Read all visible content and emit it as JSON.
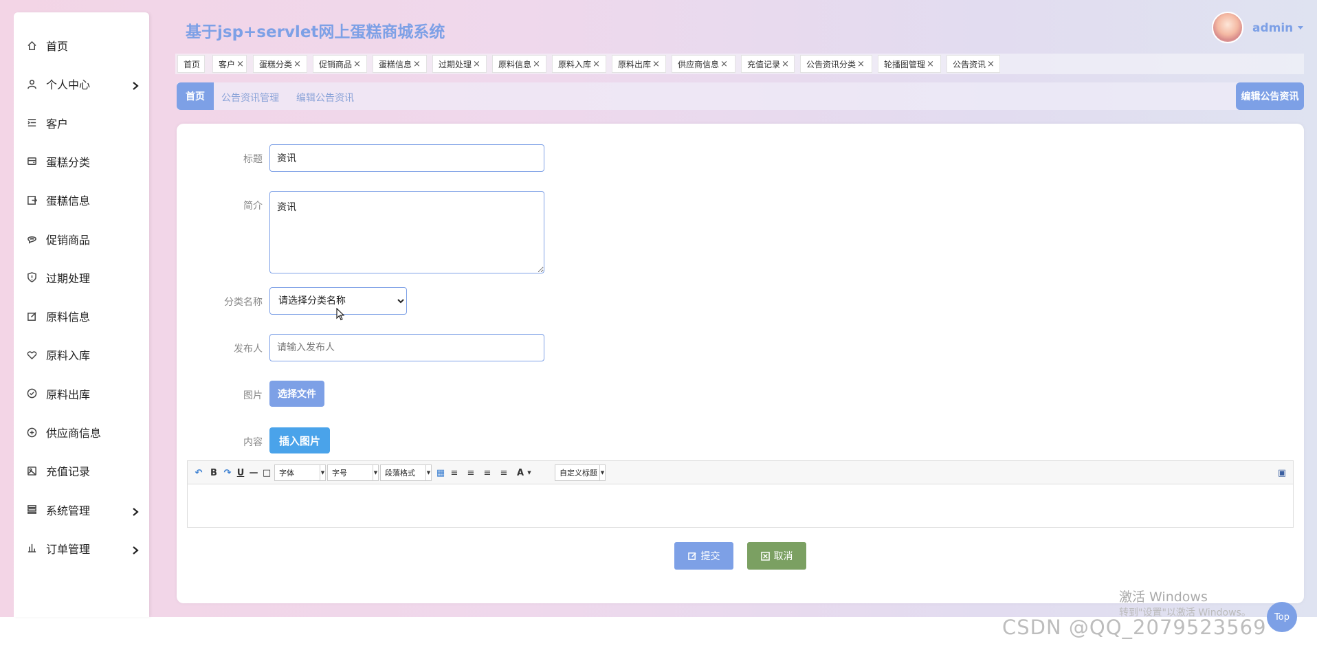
{
  "header": {
    "title": "基于jsp+servlet网上蛋糕商城系统",
    "username": "admin"
  },
  "sidebar": {
    "items": [
      {
        "label": "首页",
        "icon": "home-icon",
        "has_children": false
      },
      {
        "label": "个人中心",
        "icon": "user-icon",
        "has_children": true
      },
      {
        "label": "客户",
        "icon": "list-indent-icon",
        "has_children": false
      },
      {
        "label": "蛋糕分类",
        "icon": "wallet-icon",
        "has_children": false
      },
      {
        "label": "蛋糕信息",
        "icon": "exit-box-icon",
        "has_children": false
      },
      {
        "label": "促销商品",
        "icon": "chat-bubble-icon",
        "has_children": false
      },
      {
        "label": "过期处理",
        "icon": "shield-alert-icon",
        "has_children": false
      },
      {
        "label": "原料信息",
        "icon": "edit-square-icon",
        "has_children": false
      },
      {
        "label": "原料入库",
        "icon": "heart-icon",
        "has_children": false
      },
      {
        "label": "原料出库",
        "icon": "check-circle-icon",
        "has_children": false
      },
      {
        "label": "供应商信息",
        "icon": "plus-circle-icon",
        "has_children": false
      },
      {
        "label": "充值记录",
        "icon": "picture-icon",
        "has_children": false
      },
      {
        "label": "系统管理",
        "icon": "stack-icon",
        "has_children": true
      },
      {
        "label": "订单管理",
        "icon": "bar-chart-icon",
        "has_children": true
      }
    ]
  },
  "tabs": [
    {
      "label": "首页",
      "closable": false
    },
    {
      "label": "客户",
      "closable": true
    },
    {
      "label": "蛋糕分类",
      "closable": true
    },
    {
      "label": "促销商品",
      "closable": true
    },
    {
      "label": "蛋糕信息",
      "closable": true
    },
    {
      "label": "过期处理",
      "closable": true
    },
    {
      "label": "原料信息",
      "closable": true
    },
    {
      "label": "原料入库",
      "closable": true
    },
    {
      "label": "原料出库",
      "closable": true
    },
    {
      "label": "供应商信息",
      "closable": true
    },
    {
      "label": "充值记录",
      "closable": true
    },
    {
      "label": "公告资讯分类",
      "closable": true
    },
    {
      "label": "轮播图管理",
      "closable": true
    },
    {
      "label": "公告资讯",
      "closable": true
    }
  ],
  "tab_close_glyph": "×",
  "breadcrumb": {
    "home": "首页",
    "items": [
      "公告资讯管理",
      "编辑公告资讯"
    ],
    "page_label": "编辑公告资讯"
  },
  "form": {
    "title_label": "标题",
    "title_value": "资讯",
    "intro_label": "简介",
    "intro_value": "资讯",
    "category_label": "分类名称",
    "category_selected": "请选择分类名称",
    "publisher_label": "发布人",
    "publisher_placeholder": "请输入发布人",
    "image_label": "图片",
    "image_button": "选择文件",
    "content_label": "内容",
    "insert_image_button": "插入图片"
  },
  "editor": {
    "font_family": "字体",
    "font_size": "字号",
    "paragraph": "段落格式",
    "custom_title": "自定义标题",
    "bold": "B",
    "underline": "U",
    "font_color": "A"
  },
  "actions": {
    "submit": "提交",
    "cancel": "取消"
  },
  "overlay": {
    "windows_activation": "激活 Windows",
    "windows_activation_hint": "转到\"设置\"以激活 Windows。",
    "top_button": "Top",
    "csdn_watermark": "CSDN @QQ_2079523569"
  },
  "colors": {
    "accent": "#7da0e6",
    "insert_button": "#4aa3ea",
    "cancel_button": "#7ba062"
  }
}
